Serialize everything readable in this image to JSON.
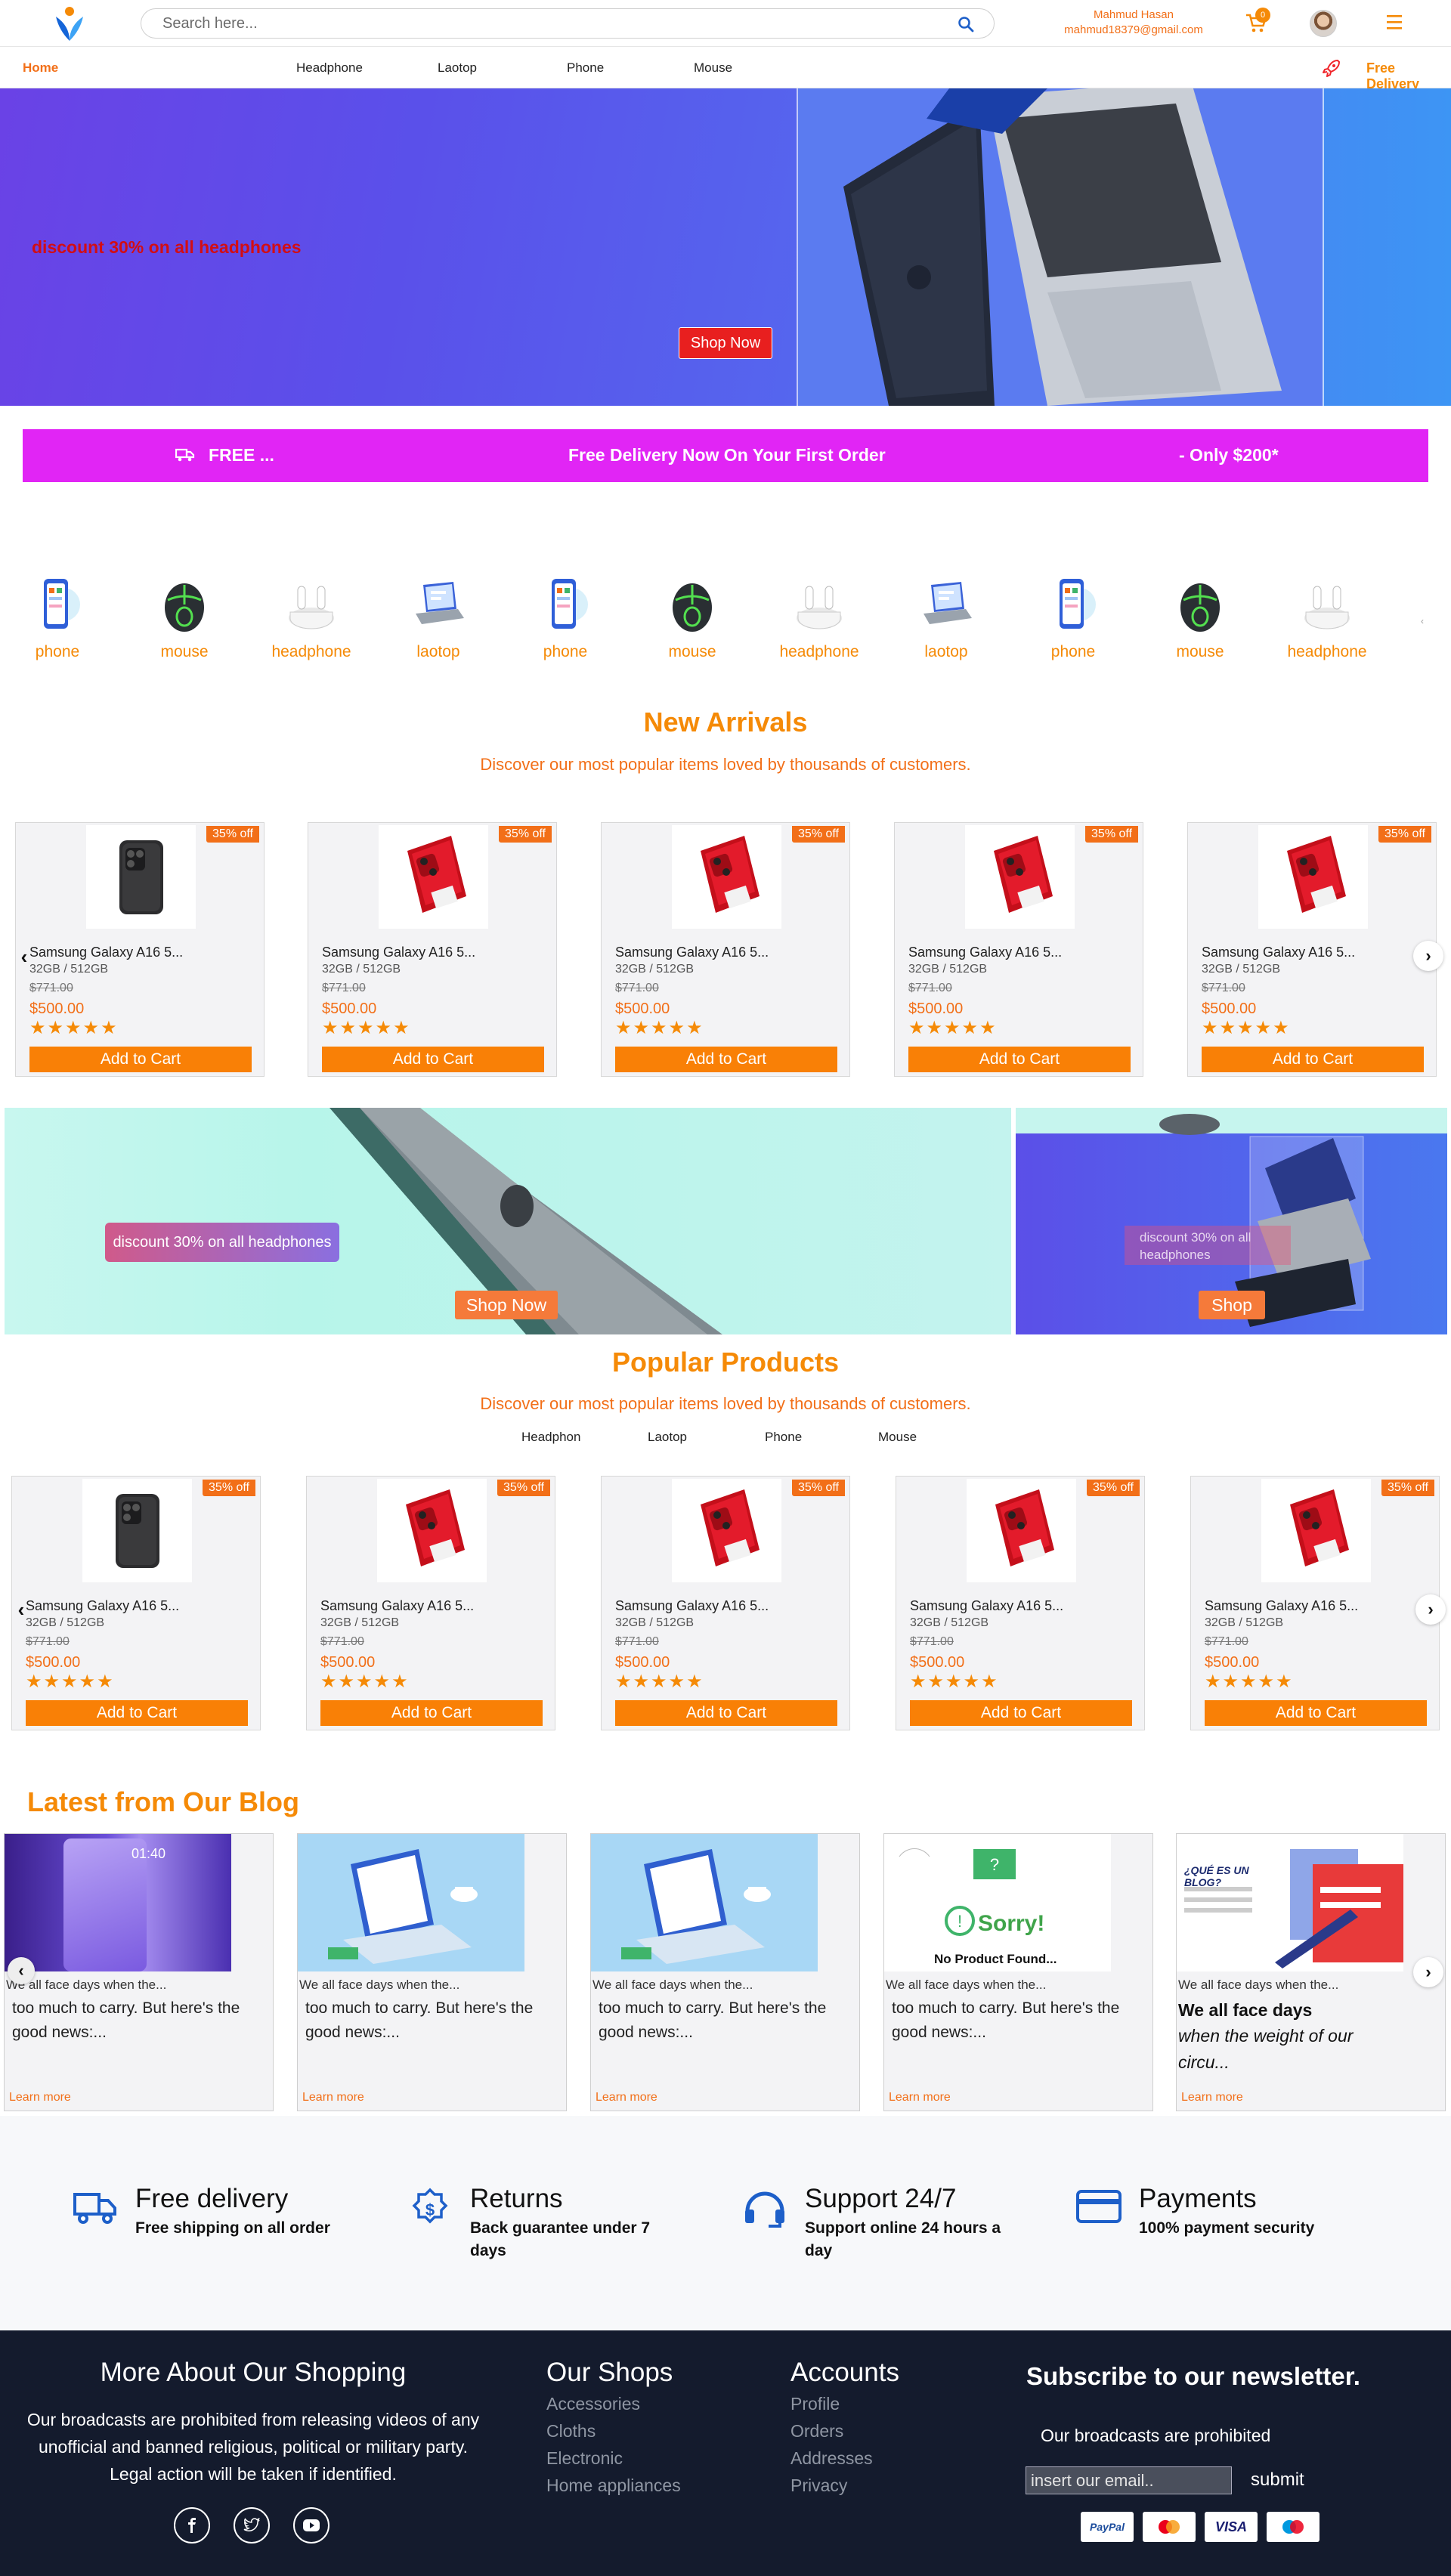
{
  "header": {
    "search_placeholder": "Search here...",
    "user_name": "Mahmud Hasan",
    "user_email": "mahmud18379@gmail.com",
    "cart_count": "0"
  },
  "nav": {
    "home": "Home",
    "items": [
      "Headphone",
      "Laotop",
      "Phone",
      "Mouse"
    ],
    "free_delivery": "Free Delivery"
  },
  "hero": {
    "text": "discount 30% on all headphones",
    "button": "Shop Now"
  },
  "promo": {
    "left": "FREE ...",
    "center": "Free Delivery Now On Your First Order",
    "right": "- Only $200*"
  },
  "categories": [
    "phone",
    "mouse",
    "headphone",
    "laotop",
    "phone",
    "mouse",
    "headphone",
    "laotop",
    "phone",
    "mouse",
    "headphone"
  ],
  "new_arrivals": {
    "title": "New Arrivals",
    "subtitle": "Discover our most popular items loved by thousands of customers.",
    "products": [
      {
        "discount": "35% off",
        "name": "Samsung Galaxy A16 5...",
        "spec": "32GB / 512GB",
        "old_price": "$771.00",
        "price": "$500.00",
        "rating": 5,
        "button": "Add to Cart"
      },
      {
        "discount": "35% off",
        "name": "Samsung Galaxy A16 5...",
        "spec": "32GB / 512GB",
        "old_price": "$771.00",
        "price": "$500.00",
        "rating": 5,
        "button": "Add to Cart"
      },
      {
        "discount": "35% off",
        "name": "Samsung Galaxy A16 5...",
        "spec": "32GB / 512GB",
        "old_price": "$771.00",
        "price": "$500.00",
        "rating": 5,
        "button": "Add to Cart"
      },
      {
        "discount": "35% off",
        "name": "Samsung Galaxy A16 5...",
        "spec": "32GB / 512GB",
        "old_price": "$771.00",
        "price": "$500.00",
        "rating": 5,
        "button": "Add to Cart"
      },
      {
        "discount": "35% off",
        "name": "Samsung Galaxy A16 5...",
        "spec": "32GB / 512GB",
        "old_price": "$771.00",
        "price": "$500.00",
        "rating": 5,
        "button": "Add to Cart"
      }
    ]
  },
  "banners": {
    "left_text": "discount 30% on all headphones",
    "left_button": "Shop Now",
    "right_text": "discount 30% on all headphones",
    "right_button": "Shop"
  },
  "popular": {
    "title": "Popular Products",
    "subtitle": "Discover our most popular items loved by thousands of customers.",
    "tabs": [
      "Headphon",
      "Laotop",
      "Phone",
      "Mouse"
    ],
    "products": [
      {
        "discount": "35% off",
        "name": "Samsung Galaxy A16 5...",
        "spec": "32GB / 512GB",
        "old_price": "$771.00",
        "price": "$500.00",
        "rating": 5,
        "button": "Add to Cart"
      },
      {
        "discount": "35% off",
        "name": "Samsung Galaxy A16 5...",
        "spec": "32GB / 512GB",
        "old_price": "$771.00",
        "price": "$500.00",
        "rating": 5,
        "button": "Add to Cart"
      },
      {
        "discount": "35% off",
        "name": "Samsung Galaxy A16 5...",
        "spec": "32GB / 512GB",
        "old_price": "$771.00",
        "price": "$500.00",
        "rating": 5,
        "button": "Add to Cart"
      },
      {
        "discount": "35% off",
        "name": "Samsung Galaxy A16 5...",
        "spec": "32GB / 512GB",
        "old_price": "$771.00",
        "price": "$500.00",
        "rating": 5,
        "button": "Add to Cart"
      },
      {
        "discount": "35% off",
        "name": "Samsung Galaxy A16 5...",
        "spec": "32GB / 512GB",
        "old_price": "$771.00",
        "price": "$500.00",
        "rating": 5,
        "button": "Add to Cart"
      }
    ]
  },
  "blog": {
    "title": "Latest from Our Blog",
    "posts": [
      {
        "excerpt": "We all face days when the...",
        "body": "too much to carry. But here's the good news:...",
        "link": "Learn more",
        "image_caption": "01:40"
      },
      {
        "excerpt": "We all face days when the...",
        "body": "too much to carry. But here's the good news:...",
        "link": "Learn more"
      },
      {
        "excerpt": "We all face days when the...",
        "body": "too much to carry. But here's the good news:...",
        "link": "Learn more"
      },
      {
        "excerpt": "We all face days when the...",
        "body": "too much to carry. But here's the good news:...",
        "link": "Learn more",
        "image_caption": "Sorry!",
        "image_caption2": "No Product Found..."
      },
      {
        "excerpt": "We all face days when the...",
        "heading": "We all face days",
        "body": "when the weight of our circu...",
        "link": "Learn more",
        "image_caption": "¿QUÉ ES UN BLOG?"
      }
    ]
  },
  "features": [
    {
      "title": "Free delivery",
      "subtitle": "Free shipping on all order",
      "icon": "truck-icon"
    },
    {
      "title": "Returns",
      "subtitle": "Back guarantee under 7 days",
      "icon": "dollar-badge-icon"
    },
    {
      "title": "Support 24/7",
      "subtitle": "Support online 24 hours a day",
      "icon": "headset-icon"
    },
    {
      "title": "Payments",
      "subtitle": "100% payment security",
      "icon": "credit-card-icon"
    }
  ],
  "footer": {
    "about_title": "More About Our Shopping",
    "about_text": "Our broadcasts are prohibited from releasing videos of any unofficial and banned religious, political or military party. Legal action will be taken if identified.",
    "shops_title": "Our Shops",
    "shops": [
      "Accessories",
      "Cloths",
      "Electronic",
      "Home appliances"
    ],
    "accounts_title": "Accounts",
    "accounts": [
      "Profile",
      "Orders",
      "Addresses",
      "Privacy"
    ],
    "newsletter_title": "Subscribe to our newsletter.",
    "newsletter_text": "Our broadcasts are prohibited",
    "email_placeholder": "insert our email..",
    "submit": "submit",
    "payments": [
      "PayPal",
      "MasterCard",
      "VISA",
      "Maestro"
    ]
  },
  "colors": {
    "accent": "#f58a07",
    "accent_dark": "#f26f18",
    "promo": "#e125f5",
    "footer": "#141b2d",
    "hero_text": "#d20d14"
  }
}
